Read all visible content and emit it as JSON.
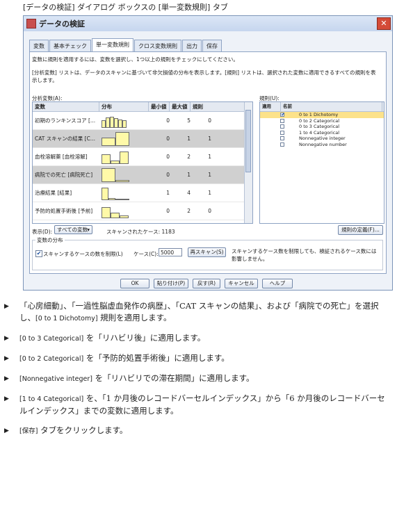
{
  "caption": "[データの検証] ダイアログ ボックスの [単一変数規則] タブ",
  "window": {
    "title": "データの検証",
    "close_glyph": "✕"
  },
  "tabs": [
    {
      "label": "変数"
    },
    {
      "label": "基本チェック"
    },
    {
      "label": "単一変数規則"
    },
    {
      "label": "クロス変数規則"
    },
    {
      "label": "出力"
    },
    {
      "label": "保存"
    }
  ],
  "panel": {
    "instruction1": "変数に規則を適用するには、変数を選択し、1つ以上の規則をチェックにしてください。",
    "instruction2a": "[分析変数] リストは、データのスキャンに基づいて非欠損値の分布を表示します。[規則] リストは、選択された変数に適用できるすべての規則を表",
    "instruction2b": "示します。",
    "analysis_label": "分析変数(A):",
    "rules_label": "規則(U):",
    "columns": {
      "var": "変数",
      "dist": "分布",
      "min": "最小値",
      "max": "最大値",
      "rule": "規則"
    },
    "variables": [
      {
        "name": "初期のランキンスコア [...",
        "min": "0",
        "max": "5",
        "rule": "0",
        "hist": [
          0.55,
          0.75,
          0.8,
          0.7,
          0.6,
          0.55
        ],
        "sel": false
      },
      {
        "name": "CAT スキャンの結果 [C...",
        "min": "0",
        "max": "1",
        "rule": "1",
        "hist": [
          0.6,
          1.0
        ],
        "sel": true
      },
      {
        "name": "血栓溶解薬 [血栓溶解]",
        "min": "0",
        "max": "2",
        "rule": "1",
        "hist": [
          0.7,
          0.25,
          0.9
        ],
        "sel": false
      },
      {
        "name": "病院での死亡 [病院死亡]",
        "min": "0",
        "max": "1",
        "rule": "1",
        "hist": [
          1.0,
          0.15
        ],
        "sel": true
      },
      {
        "name": "治療結果 [結果]",
        "min": "1",
        "max": "4",
        "rule": "1",
        "hist": [
          0.9,
          0.15,
          0.1,
          0.1
        ],
        "sel": false
      },
      {
        "name": "予防的処置手術後 [予前]",
        "min": "0",
        "max": "2",
        "rule": "0",
        "hist": [
          0.8,
          0.4,
          0.2
        ],
        "sel": false
      }
    ],
    "rule_columns": {
      "apply": "適用",
      "name": "名前"
    },
    "rules": [
      {
        "name": "0 to 1 Dichotomy",
        "checked": true,
        "hl": true
      },
      {
        "name": "0 to 2 Categorical",
        "checked": false,
        "hl": false
      },
      {
        "name": "0 to 3 Categorical",
        "checked": false,
        "hl": false
      },
      {
        "name": "1 to 4 Categorical",
        "checked": false,
        "hl": false
      },
      {
        "name": "Nonnegative integer",
        "checked": false,
        "hl": false
      },
      {
        "name": "Nonnegative number",
        "checked": false,
        "hl": false
      }
    ],
    "display_label": "表示(D):",
    "display_value": "すべての変数",
    "scanned_label": "スキャンされたケース: 1183",
    "define_rules_button": "規則の定義(F)...",
    "dist_group_label": "変数の分布",
    "limit_checkbox_label": "スキャンするケースの数を制限(L)",
    "cases_label": "ケース(C):",
    "cases_value": "5000",
    "rescan_button": "再スキャン(S)",
    "note": "スキャンするケース数を制限しても、検証されるケース数には影響しません。"
  },
  "buttons": {
    "ok": "OK",
    "paste": "貼り付け(P)",
    "reset": "戻す(R)",
    "cancel": "キャンセル",
    "help": "ヘルプ"
  },
  "bullets": [
    {
      "parts": [
        {
          "t": "「心房細動」、「一過性脳虚血発作の病歴」、「CAT スキャンの結果」、および「病院での死亡」を選択し、"
        },
        {
          "t": "[0 to 1 Dichotomy]",
          "s": true
        },
        {
          "t": " 規則を適用します。"
        }
      ]
    },
    {
      "parts": [
        {
          "t": "[0 to 3 Categorical]",
          "s": true
        },
        {
          "t": " を「リハビリ後」に適用します。"
        }
      ]
    },
    {
      "parts": [
        {
          "t": "[0 to 2 Categorical]",
          "s": true
        },
        {
          "t": " を「予防的処置手術後」に適用します。"
        }
      ]
    },
    {
      "parts": [
        {
          "t": "[Nonnegative integer]",
          "s": true
        },
        {
          "t": " を「リハビリでの滞在期間」に適用します。"
        }
      ]
    },
    {
      "parts": [
        {
          "t": "[1 to 4 Categorical]",
          "s": true
        },
        {
          "t": " を、「1 か月後のレコードバーセルインデックス」から「6 か月後のレコードバーセルインデックス」までの変数に適用します。"
        }
      ]
    },
    {
      "parts": [
        {
          "t": "[保存]",
          "s": true
        },
        {
          "t": " タブをクリックします。"
        }
      ]
    }
  ],
  "bullet_glyph": "▶"
}
